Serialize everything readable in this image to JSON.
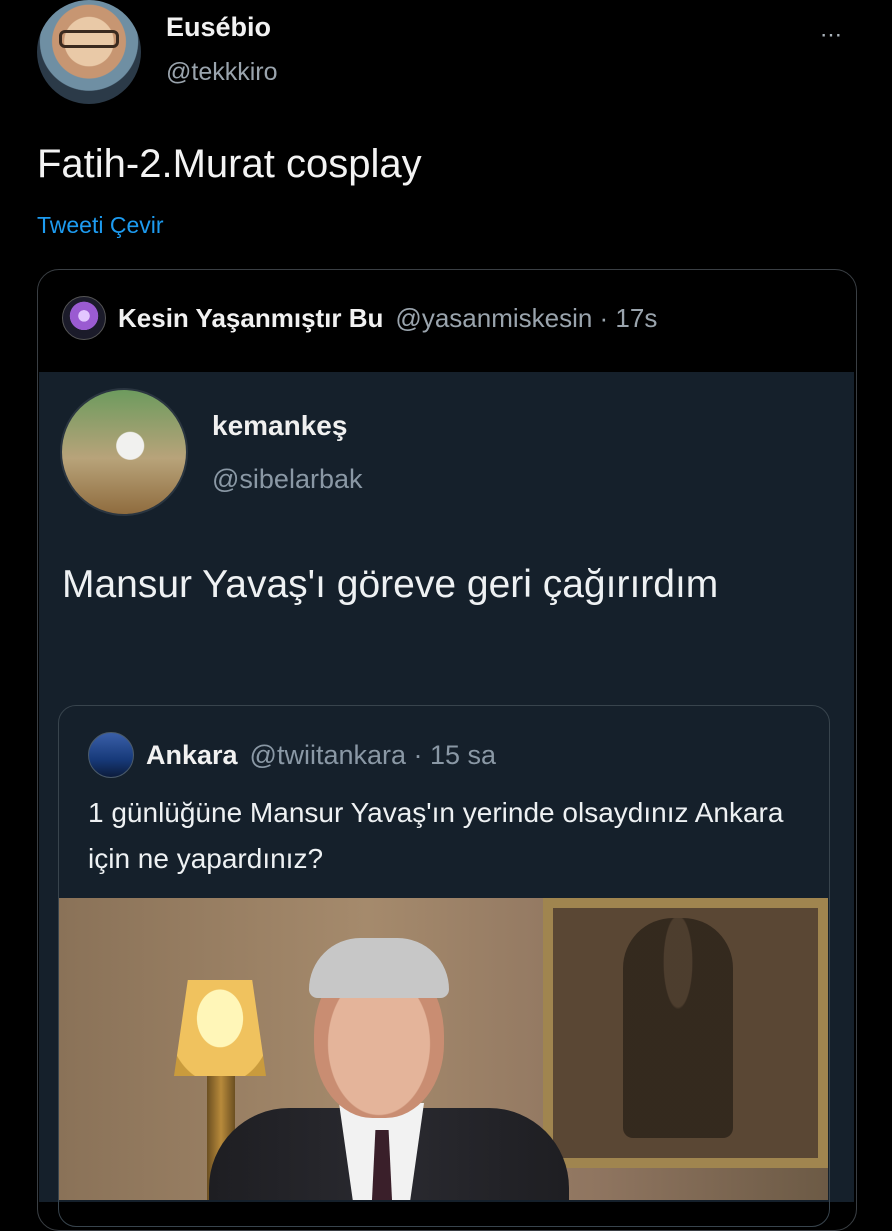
{
  "tweet": {
    "author_name": "Eusébio",
    "author_handle": "@tekkkiro",
    "more_icon": "⋯",
    "text": "Fatih-2.Murat cosplay",
    "translate_label": "Tweeti Çevir"
  },
  "quoted": {
    "name": "Kesin Yaşanmıştır Bu",
    "handle_time": "@yasanmiskesin · 17s",
    "embedded": {
      "name": "kemankeş",
      "handle": "@sibelarbak",
      "text": "Mansur Yavaş'ı göreve geri çağırırdım",
      "nested": {
        "name": "Ankara",
        "handle_time": "@twiitankara · 15 sa",
        "text": "1 günlüğüne Mansur Yavaş'ın yerinde olsaydınız Ankara için ne yapardınız?"
      }
    }
  },
  "colors": {
    "background": "#000000",
    "link": "#1d9bf0",
    "embedded_bg": "#15202b"
  }
}
